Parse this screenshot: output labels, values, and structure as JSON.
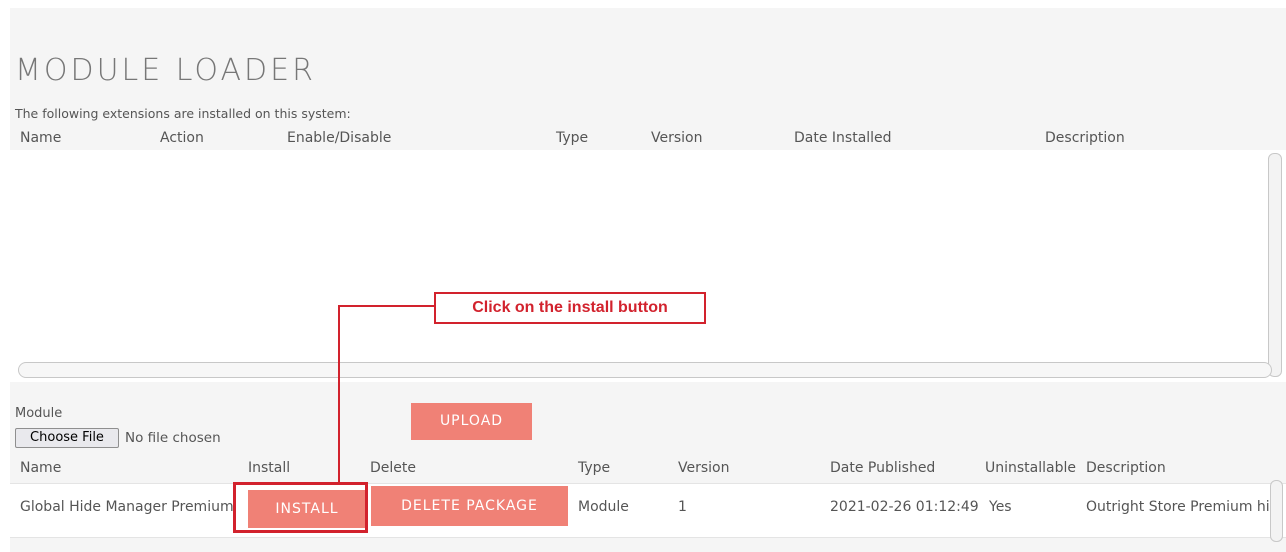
{
  "page": {
    "title": "MODULE LOADER",
    "subtitle": "The following extensions are installed on this system:"
  },
  "installed_table": {
    "headers": {
      "name": "Name",
      "action": "Action",
      "enable_disable": "Enable/Disable",
      "type": "Type",
      "version": "Version",
      "date_installed": "Date Installed",
      "description": "Description"
    },
    "rows": []
  },
  "upload": {
    "module_label": "Module",
    "choose_file_label": "Choose File",
    "no_file_text": "No file chosen",
    "upload_label": "UPLOAD"
  },
  "available_table": {
    "headers": {
      "name": "Name",
      "install": "Install",
      "delete": "Delete",
      "type": "Type",
      "version": "Version",
      "date_published": "Date Published",
      "uninstallable": "Uninstallable",
      "description": "Description"
    },
    "rows": [
      {
        "name": "Global Hide Manager Premium",
        "install_label": "INSTALL",
        "delete_label": "DELETE PACKAGE",
        "type": "Module",
        "version": "1",
        "date_published": "2021-02-26 01:12:49",
        "uninstallable": "Yes",
        "description": "Outright Store Premium hi"
      }
    ]
  },
  "annotation": {
    "text": "Click on the install button",
    "color": "#d2222d"
  },
  "colors": {
    "accent": "#f08176",
    "annotation": "#d2222d",
    "background": "#f5f5f5"
  }
}
